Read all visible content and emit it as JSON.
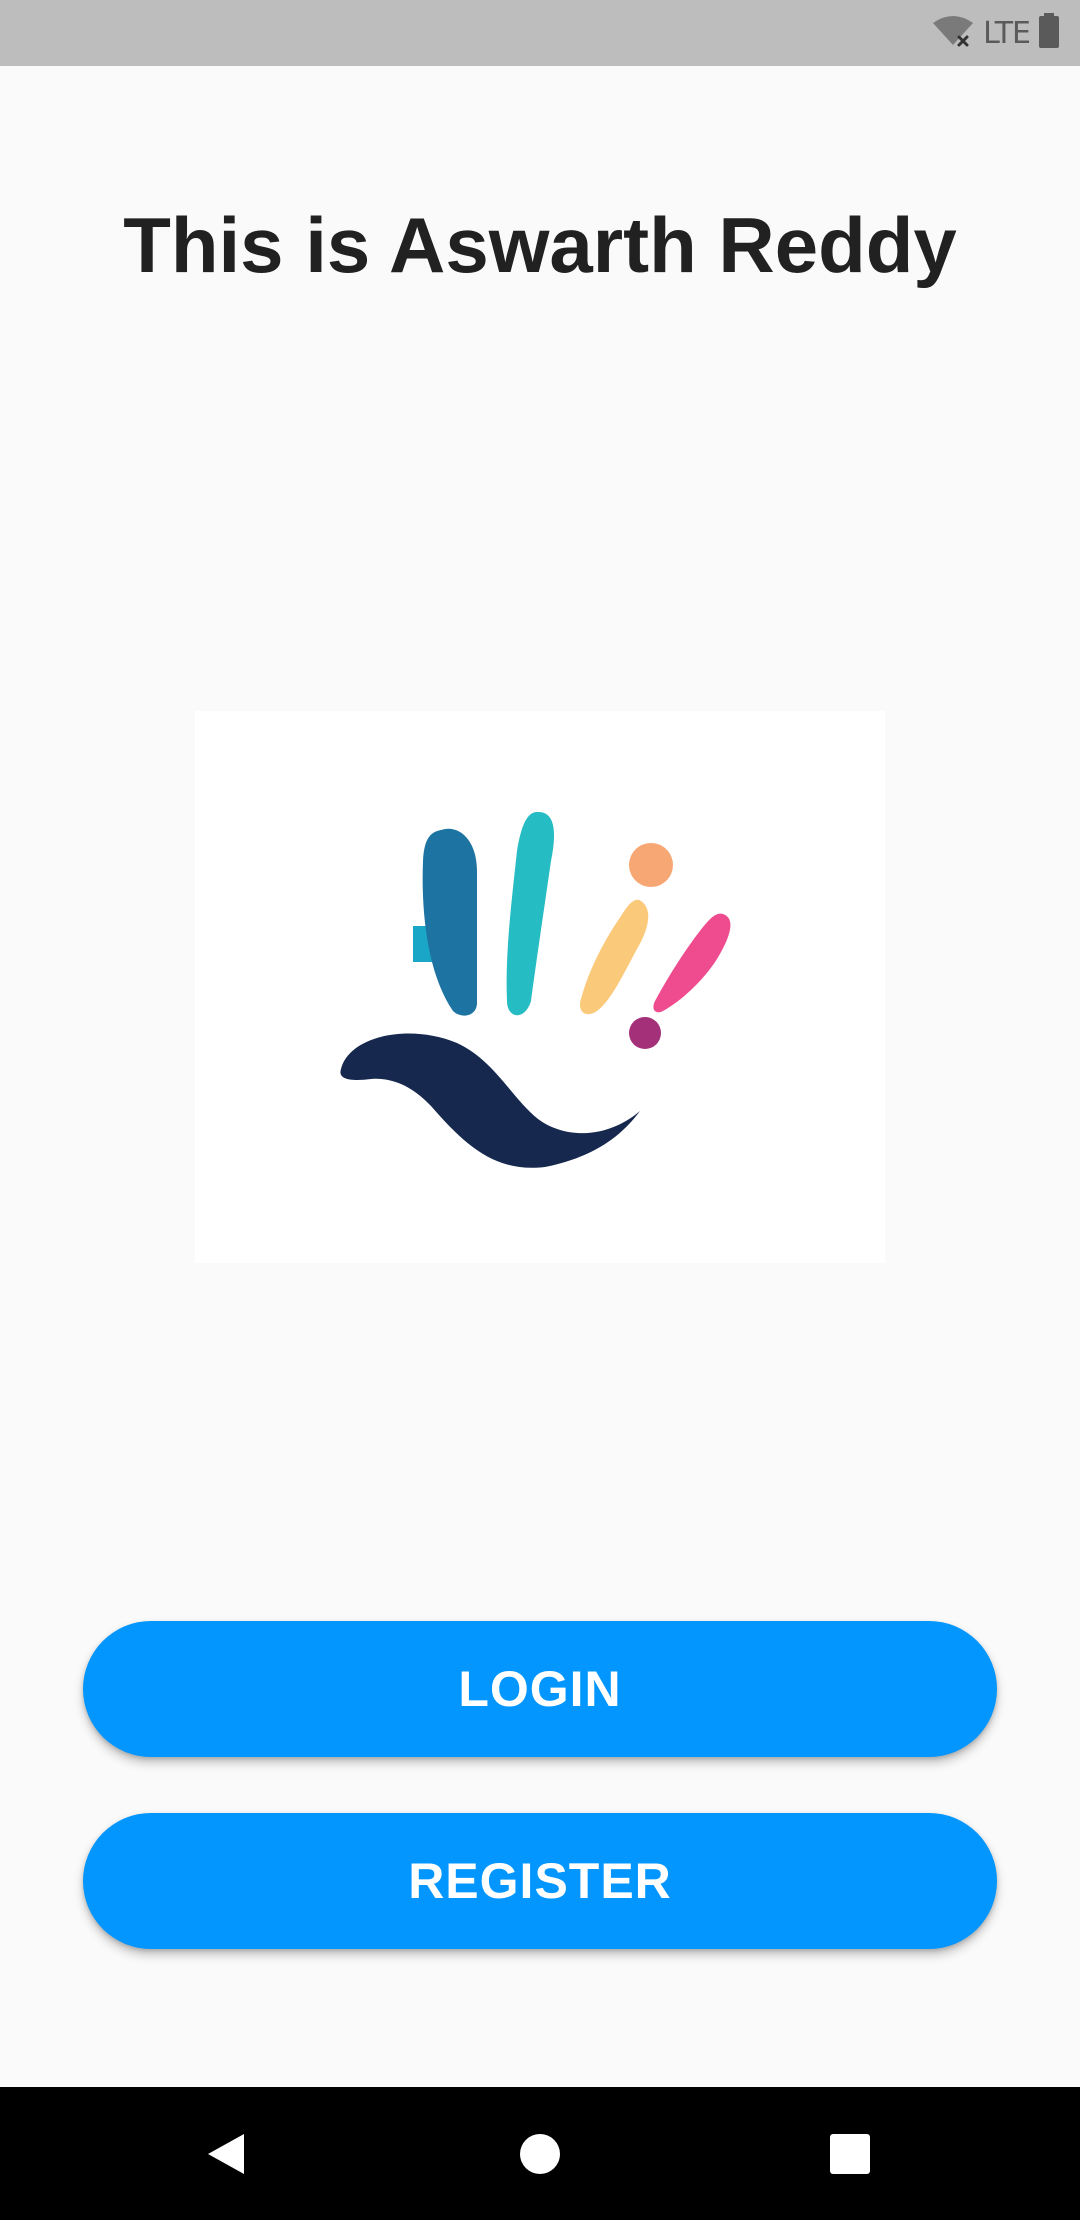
{
  "status_bar": {
    "network_label": "LTE",
    "icons": [
      "wifi-off-icon",
      "battery-icon"
    ]
  },
  "title": "This is Aswarth Reddy",
  "logo": {
    "description_icon": "hi-hand-logo",
    "colors": {
      "h_left": "#1d73a1",
      "h_bar": "#1aa7c7",
      "h_right": "#26bcc4",
      "i_stem": "#fbc97a",
      "i_dot": "#f7a774",
      "exclaim": "#ef4b8f",
      "exclaim_dot": "#a4307a",
      "wave": "#16284e"
    }
  },
  "buttons": {
    "login": "LOGIN",
    "register": "REGISTER"
  },
  "colors": {
    "accent": "#0396fe",
    "status_bar_bg": "#bdbdbd",
    "nav_bar_bg": "#000000",
    "background": "#fafafa"
  },
  "nav_bar": {
    "icons": [
      "back-icon",
      "home-icon",
      "recents-icon"
    ]
  }
}
